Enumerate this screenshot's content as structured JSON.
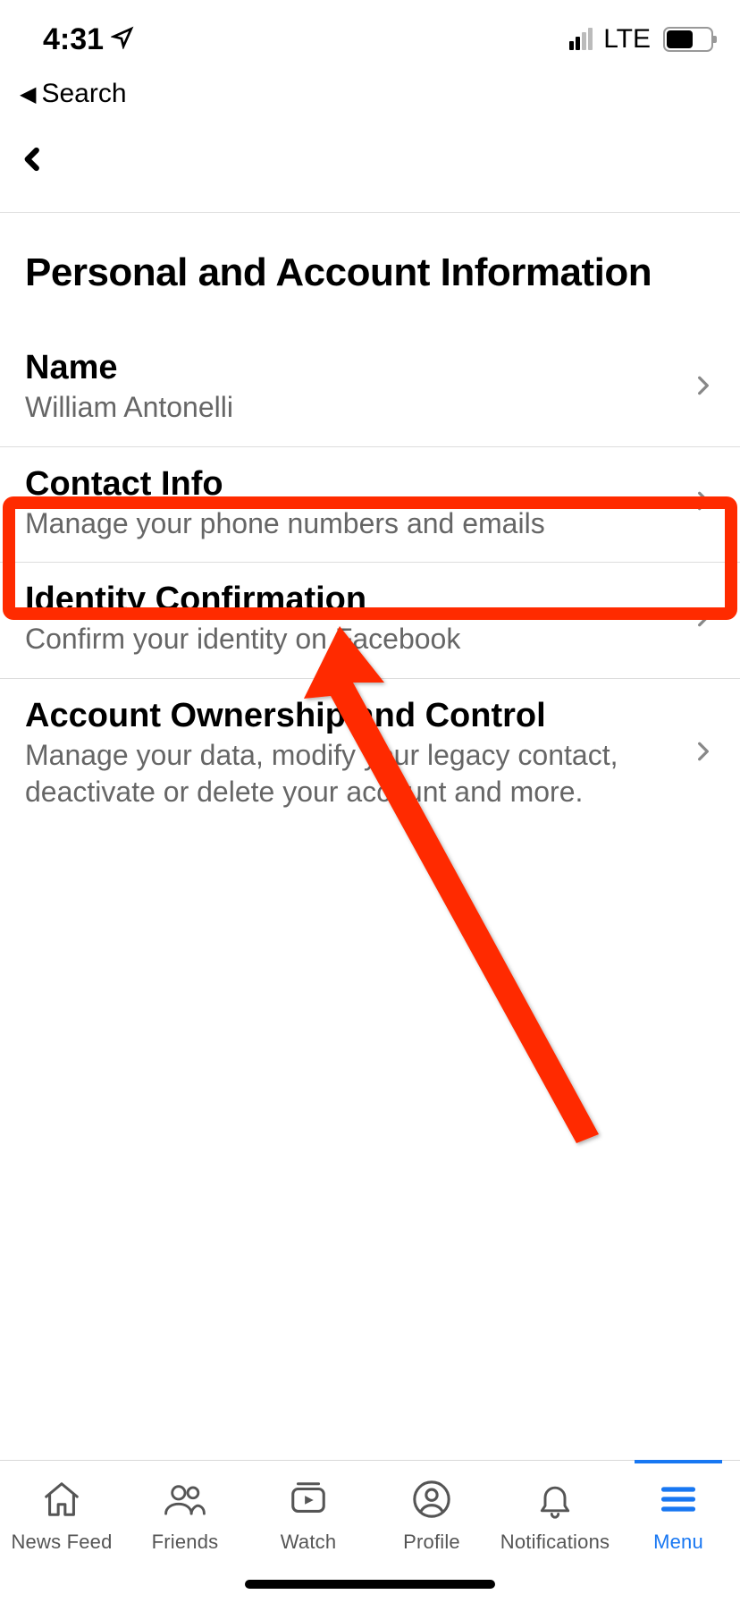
{
  "status": {
    "time": "4:31",
    "carrier": "LTE"
  },
  "breadcrumb": {
    "label": "Search"
  },
  "page": {
    "title": "Personal and Account Information"
  },
  "settings": [
    {
      "title": "Name",
      "subtitle": "William Antonelli"
    },
    {
      "title": "Contact Info",
      "subtitle": "Manage your phone numbers and emails"
    },
    {
      "title": "Identity Confirmation",
      "subtitle": "Confirm your identity on Facebook"
    },
    {
      "title": "Account Ownership and Control",
      "subtitle": "Manage your data, modify your legacy contact, deactivate or delete your account and more."
    }
  ],
  "tabs": [
    {
      "label": "News Feed"
    },
    {
      "label": "Friends"
    },
    {
      "label": "Watch"
    },
    {
      "label": "Profile"
    },
    {
      "label": "Notifications"
    },
    {
      "label": "Menu"
    }
  ],
  "annotation": {
    "highlight_color": "#ff2b00"
  }
}
